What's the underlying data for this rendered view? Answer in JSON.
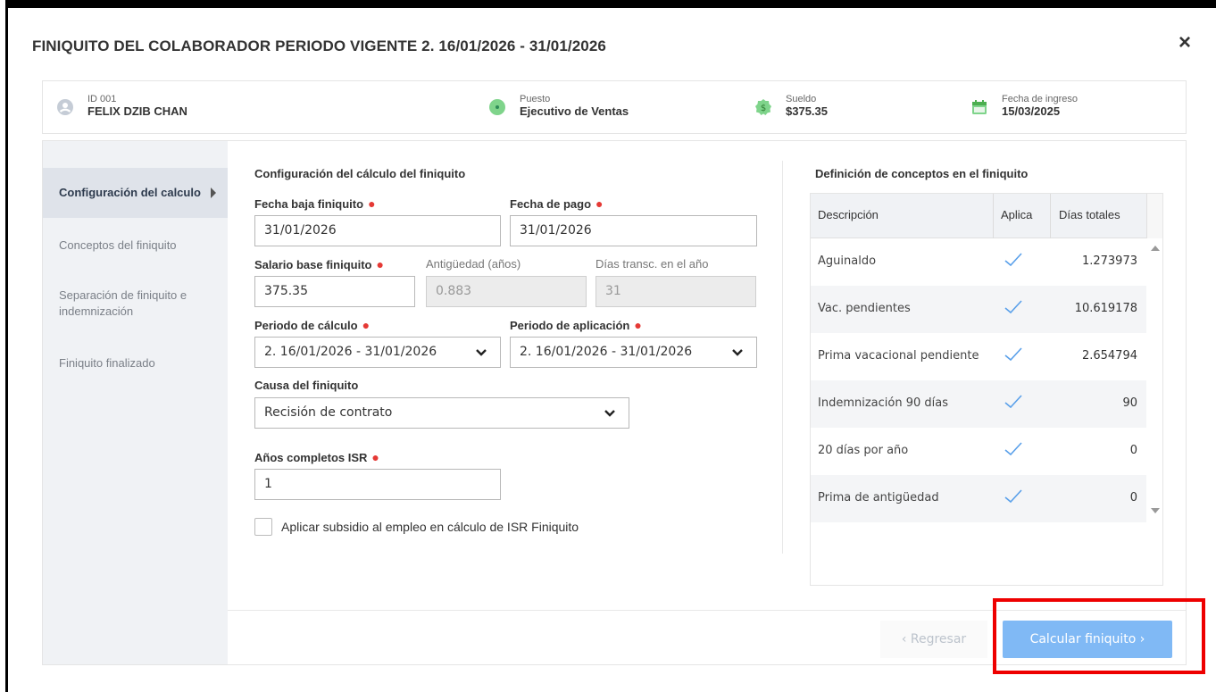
{
  "modal": {
    "title": "FINIQUITO DEL COLABORADOR  PERIODO VIGENTE 2. 16/01/2026 - 31/01/2026",
    "close_icon": "×"
  },
  "employee": {
    "id_label": "ID 001",
    "name": "FELIX DZIB CHAN",
    "position_label": "Puesto",
    "position_value": "Ejecutivo de Ventas",
    "salary_label": "Sueldo",
    "salary_value": "$375.35",
    "hire_label": "Fecha de ingreso",
    "hire_value": "15/03/2025"
  },
  "sidebar": {
    "items": [
      {
        "label": "Configuración del calculo"
      },
      {
        "label": "Conceptos del finiquito"
      },
      {
        "label": "Separación de finiquito e indemnización"
      },
      {
        "label": "Finiquito finalizado"
      }
    ]
  },
  "config": {
    "section_title": "Configuración del cálculo del finiquito",
    "fecha_baja_label": "Fecha baja finiquito",
    "fecha_baja_value": "31/01/2026",
    "fecha_pago_label": "Fecha de pago",
    "fecha_pago_value": "31/01/2026",
    "salario_label": "Salario base finiquito",
    "salario_value": "375.35",
    "antiguedad_label": "Antigüedad (años)",
    "antiguedad_value": "0.883",
    "dias_label": "Días transc. en el año",
    "dias_value": "31",
    "periodo_calc_label": "Periodo de cálculo",
    "periodo_calc_value": "2. 16/01/2026 - 31/01/2026",
    "periodo_apl_label": "Periodo de aplicación",
    "periodo_apl_value": "2. 16/01/2026 - 31/01/2026",
    "causa_label": "Causa del finiquito",
    "causa_value": "Recisión de contrato",
    "anios_isr_label": "Años completos ISR",
    "anios_isr_value": "1",
    "subsidio_label": "Aplicar subsidio al empleo en cálculo de ISR Finiquito",
    "subsidio_checked": false
  },
  "concepts": {
    "title": "Definición de conceptos en el finiquito",
    "headers": {
      "desc": "Descripción",
      "aplica": "Aplica",
      "dias": "Días totales"
    },
    "rows": [
      {
        "desc": "Aguinaldo",
        "aplica": true,
        "dias": "1.273973"
      },
      {
        "desc": "Vac. pendientes",
        "aplica": true,
        "dias": "10.619178"
      },
      {
        "desc": "Prima vacacional pendiente",
        "aplica": true,
        "dias": "2.654794"
      },
      {
        "desc": "Indemnización 90 días",
        "aplica": true,
        "dias": "90"
      },
      {
        "desc": "20 días por año",
        "aplica": true,
        "dias": "0"
      },
      {
        "desc": "Prima de antigüedad",
        "aplica": true,
        "dias": "0"
      }
    ]
  },
  "footer": {
    "back_label": "‹ Regresar",
    "calc_label": "Calcular finiquito ›"
  },
  "colors": {
    "accent": "#80b9f5",
    "required": "#e53935",
    "icon_green": "#7fd48b",
    "highlight": "#ee0000"
  }
}
